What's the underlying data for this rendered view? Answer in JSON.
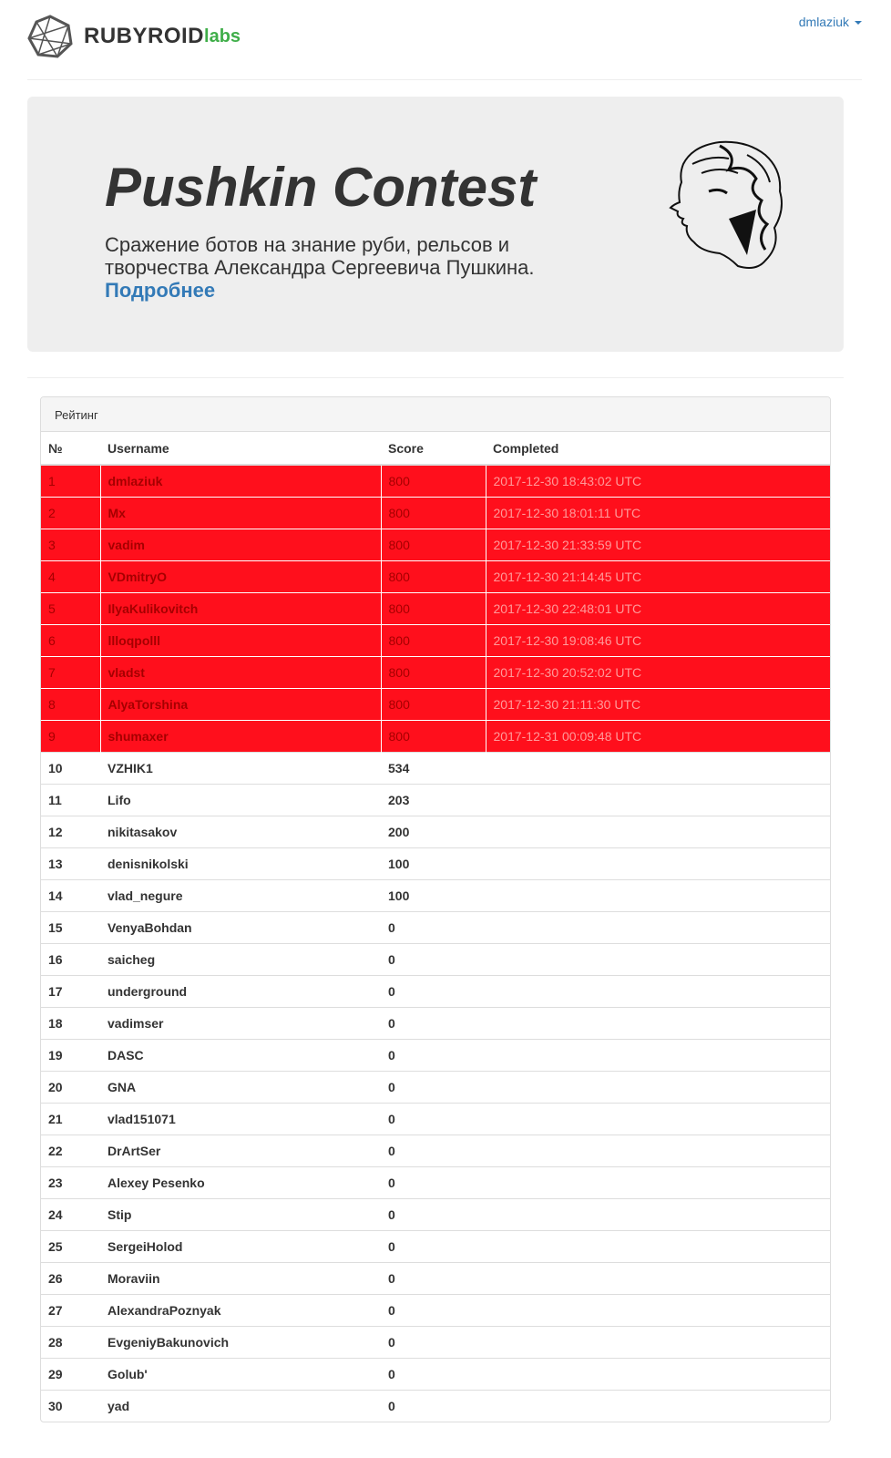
{
  "header": {
    "brand_main": "RUBYROID",
    "brand_sub": "labs",
    "user": "dmlaziuk"
  },
  "jumbotron": {
    "title": "Pushkin Contest",
    "description": "Сражение ботов на знание руби, рельсов и творчества Александра Сергеевича Пушкина.",
    "link": "Подробнее",
    "portrait_icon": "pushkin-portrait"
  },
  "rating": {
    "heading": "Рейтинг",
    "columns": [
      "№",
      "Username",
      "Score",
      "Completed"
    ],
    "highlight_color": "#ff0f1c",
    "rows": [
      {
        "n": "1",
        "user": "dmlaziuk",
        "score": "800",
        "completed": "2017-12-30 18:43:02 UTC"
      },
      {
        "n": "2",
        "user": "Mx",
        "score": "800",
        "completed": "2017-12-30 18:01:11 UTC"
      },
      {
        "n": "3",
        "user": "vadim",
        "score": "800",
        "completed": "2017-12-30 21:33:59 UTC"
      },
      {
        "n": "4",
        "user": "VDmitryO",
        "score": "800",
        "completed": "2017-12-30 21:14:45 UTC"
      },
      {
        "n": "5",
        "user": "IlyaKulikovitch",
        "score": "800",
        "completed": "2017-12-30 22:48:01 UTC"
      },
      {
        "n": "6",
        "user": "llloqpolll",
        "score": "800",
        "completed": "2017-12-30 19:08:46 UTC"
      },
      {
        "n": "7",
        "user": "vladst",
        "score": "800",
        "completed": "2017-12-30 20:52:02 UTC"
      },
      {
        "n": "8",
        "user": "AlyaTorshina",
        "score": "800",
        "completed": "2017-12-30 21:11:30 UTC"
      },
      {
        "n": "9",
        "user": "shumaxer",
        "score": "800",
        "completed": "2017-12-31 00:09:48 UTC"
      },
      {
        "n": "10",
        "user": "VZHIK1",
        "score": "534",
        "completed": ""
      },
      {
        "n": "11",
        "user": "Lifo",
        "score": "203",
        "completed": ""
      },
      {
        "n": "12",
        "user": "nikitasakov",
        "score": "200",
        "completed": ""
      },
      {
        "n": "13",
        "user": "denisnikolski",
        "score": "100",
        "completed": ""
      },
      {
        "n": "14",
        "user": "vlad_negure",
        "score": "100",
        "completed": ""
      },
      {
        "n": "15",
        "user": "VenyaBohdan",
        "score": "0",
        "completed": ""
      },
      {
        "n": "16",
        "user": "saicheg",
        "score": "0",
        "completed": ""
      },
      {
        "n": "17",
        "user": "underground",
        "score": "0",
        "completed": ""
      },
      {
        "n": "18",
        "user": "vadimser",
        "score": "0",
        "completed": ""
      },
      {
        "n": "19",
        "user": "DASC",
        "score": "0",
        "completed": ""
      },
      {
        "n": "20",
        "user": "GNA",
        "score": "0",
        "completed": ""
      },
      {
        "n": "21",
        "user": "vlad151071",
        "score": "0",
        "completed": ""
      },
      {
        "n": "22",
        "user": "DrArtSer",
        "score": "0",
        "completed": ""
      },
      {
        "n": "23",
        "user": "Alexey Pesenko",
        "score": "0",
        "completed": ""
      },
      {
        "n": "24",
        "user": "Stip",
        "score": "0",
        "completed": ""
      },
      {
        "n": "25",
        "user": "SergeiHolod",
        "score": "0",
        "completed": ""
      },
      {
        "n": "26",
        "user": "Moraviin",
        "score": "0",
        "completed": ""
      },
      {
        "n": "27",
        "user": "AlexandraPoznyak",
        "score": "0",
        "completed": ""
      },
      {
        "n": "28",
        "user": "EvgeniyBakunovich",
        "score": "0",
        "completed": ""
      },
      {
        "n": "29",
        "user": "Golub'",
        "score": "0",
        "completed": ""
      },
      {
        "n": "30",
        "user": "yad",
        "score": "0",
        "completed": ""
      }
    ]
  }
}
